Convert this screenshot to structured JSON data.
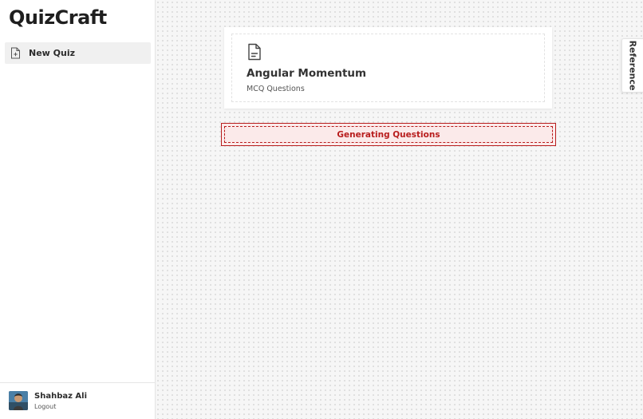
{
  "app": {
    "title": "QuizCraft"
  },
  "sidebar": {
    "items": [
      {
        "label": "New Quiz",
        "icon": "file-plus-icon"
      }
    ],
    "user": {
      "name": "Shahbaz Ali",
      "logout_label": "Logout"
    }
  },
  "main": {
    "card": {
      "icon": "document-icon",
      "title": "Angular Momentum",
      "subtitle": "MCQ Questions"
    },
    "status_button": {
      "label": "Generating Questions"
    },
    "side_tab": {
      "label": "Reference"
    }
  },
  "colors": {
    "accent_red": "#b81d1d",
    "text_dark": "#333333",
    "canvas_bg": "#f6f6f6"
  }
}
